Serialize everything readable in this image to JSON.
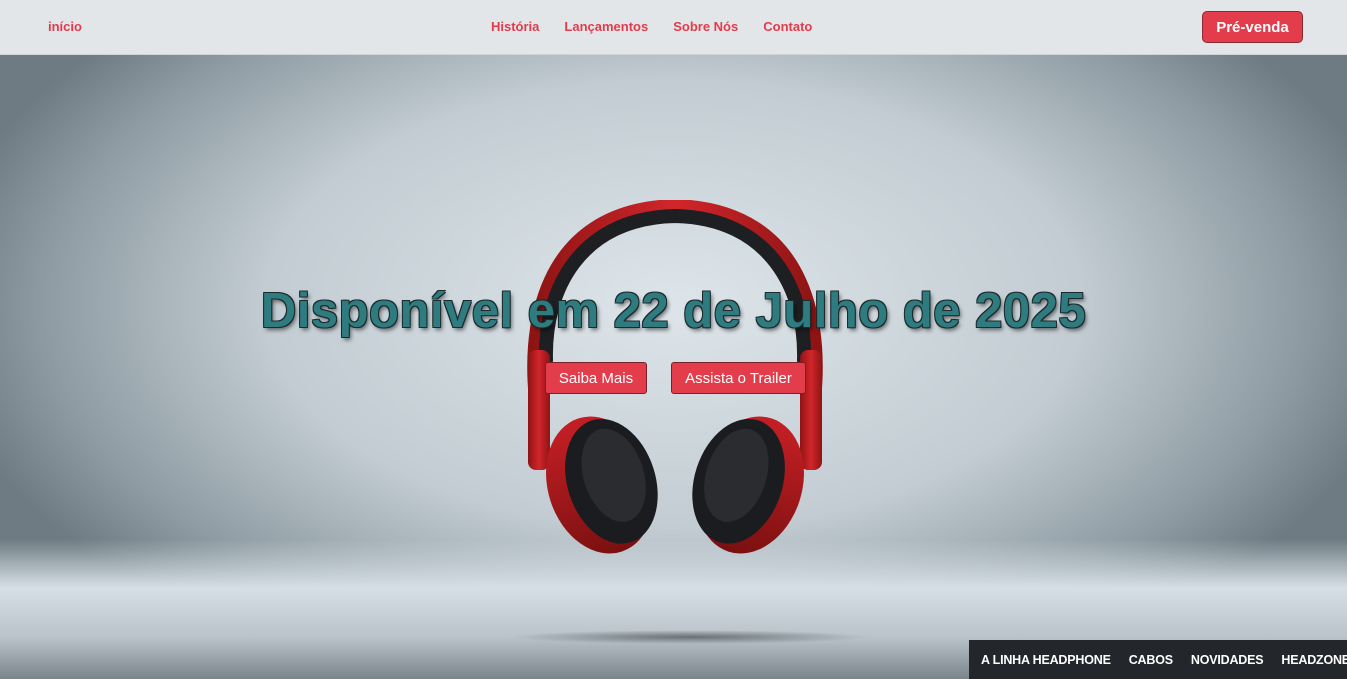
{
  "nav": {
    "home_label": "início",
    "links": [
      {
        "label": "História"
      },
      {
        "label": "Lançamentos"
      },
      {
        "label": "Sobre Nós"
      },
      {
        "label": "Contato"
      }
    ],
    "preorder_label": "Pré-venda"
  },
  "hero": {
    "title": "Disponível em 22 de Julho de 2025",
    "learn_more_label": "Saiba Mais",
    "trailer_label": "Assista o Trailer"
  },
  "category_bar": {
    "items": [
      {
        "label": "A LINHA HEADPHONE"
      },
      {
        "label": "CABOS"
      },
      {
        "label": "NOVIDADES"
      },
      {
        "label": "HEADZONE"
      }
    ]
  },
  "colors": {
    "accent": "#e33c4b",
    "title": "#2f7c80",
    "navbar_bg": "#e3e6e9",
    "category_bar_bg": "#23272b"
  }
}
